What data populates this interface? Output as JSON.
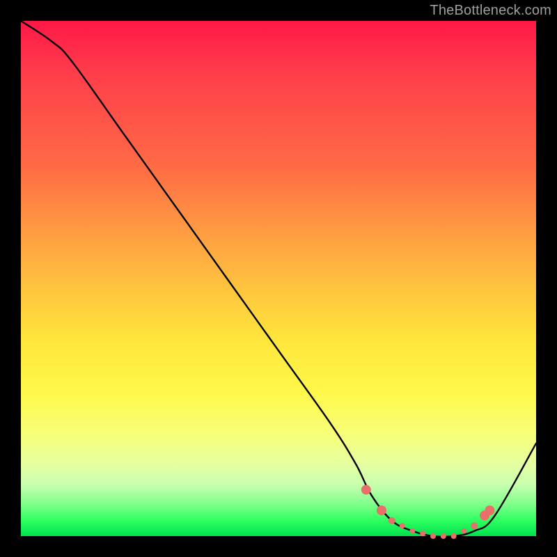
{
  "watermark": "TheBottleneck.com",
  "chart_data": {
    "type": "line",
    "title": "",
    "xlabel": "",
    "ylabel": "",
    "xlim": [
      0,
      100
    ],
    "ylim": [
      0,
      100
    ],
    "series": [
      {
        "name": "bottleneck-curve",
        "x": [
          0,
          6,
          10,
          20,
          30,
          40,
          50,
          60,
          65,
          68,
          72,
          76,
          80,
          84,
          88,
          92,
          100
        ],
        "values": [
          100,
          96,
          92,
          78,
          64,
          50,
          36,
          22,
          14,
          8,
          3,
          1,
          0,
          0,
          1,
          4,
          18
        ]
      }
    ],
    "markers": {
      "name": "optimal-range",
      "color": "#e86f6a",
      "points_x": [
        67,
        70,
        72,
        74,
        76,
        78,
        80,
        82,
        84,
        86,
        88,
        90,
        91
      ],
      "points_y": [
        9,
        5,
        3,
        2,
        1,
        0.5,
        0,
        0,
        0,
        1,
        2,
        4,
        5
      ]
    },
    "gradient_stops": [
      {
        "pos": 0,
        "color": "#ff1846"
      },
      {
        "pos": 50,
        "color": "#ffc43e"
      },
      {
        "pos": 80,
        "color": "#f8ff78"
      },
      {
        "pos": 100,
        "color": "#00e24e"
      }
    ]
  }
}
